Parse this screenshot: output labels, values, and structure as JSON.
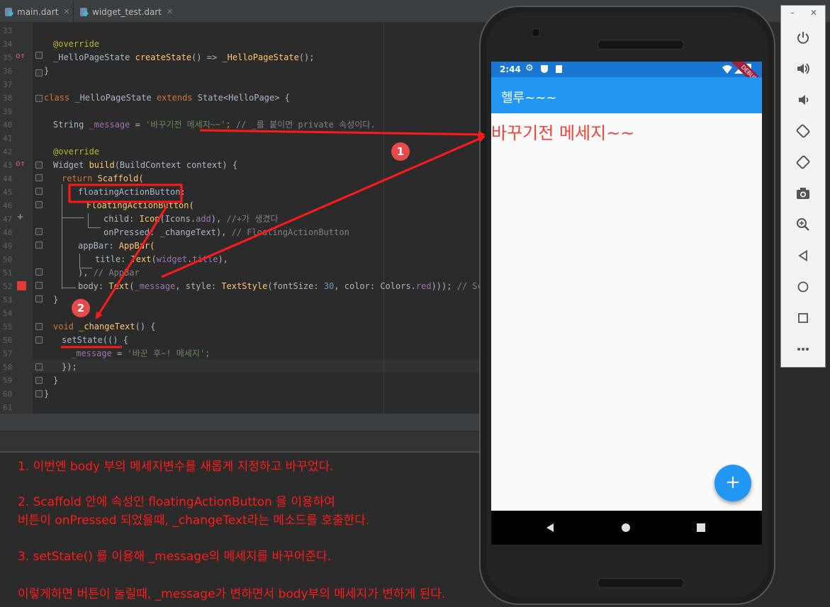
{
  "tabs": [
    {
      "label": "main.dart"
    },
    {
      "label": "widget_test.dart"
    }
  ],
  "code_lines": [
    {
      "n": "33"
    },
    {
      "n": "34"
    },
    {
      "n": "35"
    },
    {
      "n": "36"
    },
    {
      "n": "37"
    },
    {
      "n": "38"
    },
    {
      "n": "39"
    },
    {
      "n": "40"
    },
    {
      "n": "41"
    },
    {
      "n": "42"
    },
    {
      "n": "43"
    },
    {
      "n": "44"
    },
    {
      "n": "45"
    },
    {
      "n": "46"
    },
    {
      "n": "47"
    },
    {
      "n": "48"
    },
    {
      "n": "49"
    },
    {
      "n": "50"
    },
    {
      "n": "51"
    },
    {
      "n": "52"
    },
    {
      "n": "53"
    },
    {
      "n": "54"
    },
    {
      "n": "55"
    },
    {
      "n": "56"
    },
    {
      "n": "57"
    },
    {
      "n": "58"
    },
    {
      "n": "59"
    },
    {
      "n": "60"
    },
    {
      "n": "61"
    }
  ],
  "code": {
    "l34": "@override",
    "l35a": "_HelloPageState ",
    "l35b": "createState",
    "l35c": "() => ",
    "l35d": "_HelloPageState",
    "l35e": "();",
    "l36": "}",
    "l38a": "class ",
    "l38b": "_HelloPageState ",
    "l38c": "extends ",
    "l38d": "State<HelloPage> {",
    "l40a": "String ",
    "l40b": "_message",
    "l40c": " = ",
    "l40d": "'바꾸기전 메세지~~'",
    "l40e": "; ",
    "l40f": "// _를 붙이면 private 속성이다.",
    "l42": "@override",
    "l43a": "Widget ",
    "l43b": "build",
    "l43c": "(BuildContext context) {",
    "l44a": "return ",
    "l44b": "Scaffold(",
    "l45": "floatingActionButton:",
    "l46": "FloatingActionButton(",
    "l47a": "child: ",
    "l47b": "Icon",
    "l47c": "(Icons.",
    "l47d": "add",
    "l47e": "), ",
    "l47f": "//+가 생겼다",
    "l48a": "onPressed: _changeText), ",
    "l48b": "// FloatingActionButton",
    "l49a": "appBar: ",
    "l49b": "AppBar(",
    "l50a": "title: ",
    "l50b": "Text",
    "l50c": "(",
    "l50d": "widget",
    "l50e": ".",
    "l50f": "title",
    "l50g": "),",
    "l51a": "), ",
    "l51b": "// AppBar",
    "l52a": "body: ",
    "l52b": "Text",
    "l52c": "(",
    "l52d": "_message",
    "l52e": ", style: ",
    "l52f": "TextStyle",
    "l52g": "(fontSize: ",
    "l52h": "30",
    "l52i": ", color: Colors.",
    "l52j": "red",
    "l52k": "))); ",
    "l52l": "// Scaffold",
    "l53": "}",
    "l55a": "void ",
    "l55b": "_changeText",
    "l55c": "() {",
    "l56": "setState(() {",
    "l57a": "_message",
    "l57b": " = ",
    "l57c": "'바꾼 후~! 메세지'",
    "l57d": ";",
    "l58": "});",
    "l59": "}",
    "l60": "}"
  },
  "notes": {
    "n1": "1. 이번엔 body 부의 메세지변수를 새롭게 지정하고 바꾸었다.",
    "n2a": "2. Scaffold 안에 속성인 floatingActionButton 을 이용하여",
    "n2b": "버튼이 onPressed 되었을때, _changeText라는 메소드를 호출한다.",
    "n3": "3. setState() 를 이용해 _message의 메세지를 바꾸어준다.",
    "n4": "이렇게하면 버튼이 눌릴때, _message가 변하면서 body부의 메세지가 변하게 된다."
  },
  "badges": {
    "b1": "1",
    "b2": "2"
  },
  "phone": {
    "time": "2:44",
    "debug": "DEBUG",
    "appbar_title": "헬루~~~",
    "body_text": "바꾸기전 메세지~~",
    "fab_label": "+"
  },
  "colors": {
    "accent": "#2196f3",
    "annotation": "#ff1a1a",
    "body_text": "#f44336"
  },
  "emulator_toolbar": {
    "icons": [
      "power-icon",
      "volume-up-icon",
      "volume-down-icon",
      "rotate-left-icon",
      "rotate-right-icon",
      "camera-icon",
      "zoom-icon",
      "back-icon",
      "home-icon",
      "overview-icon",
      "more-icon"
    ]
  }
}
